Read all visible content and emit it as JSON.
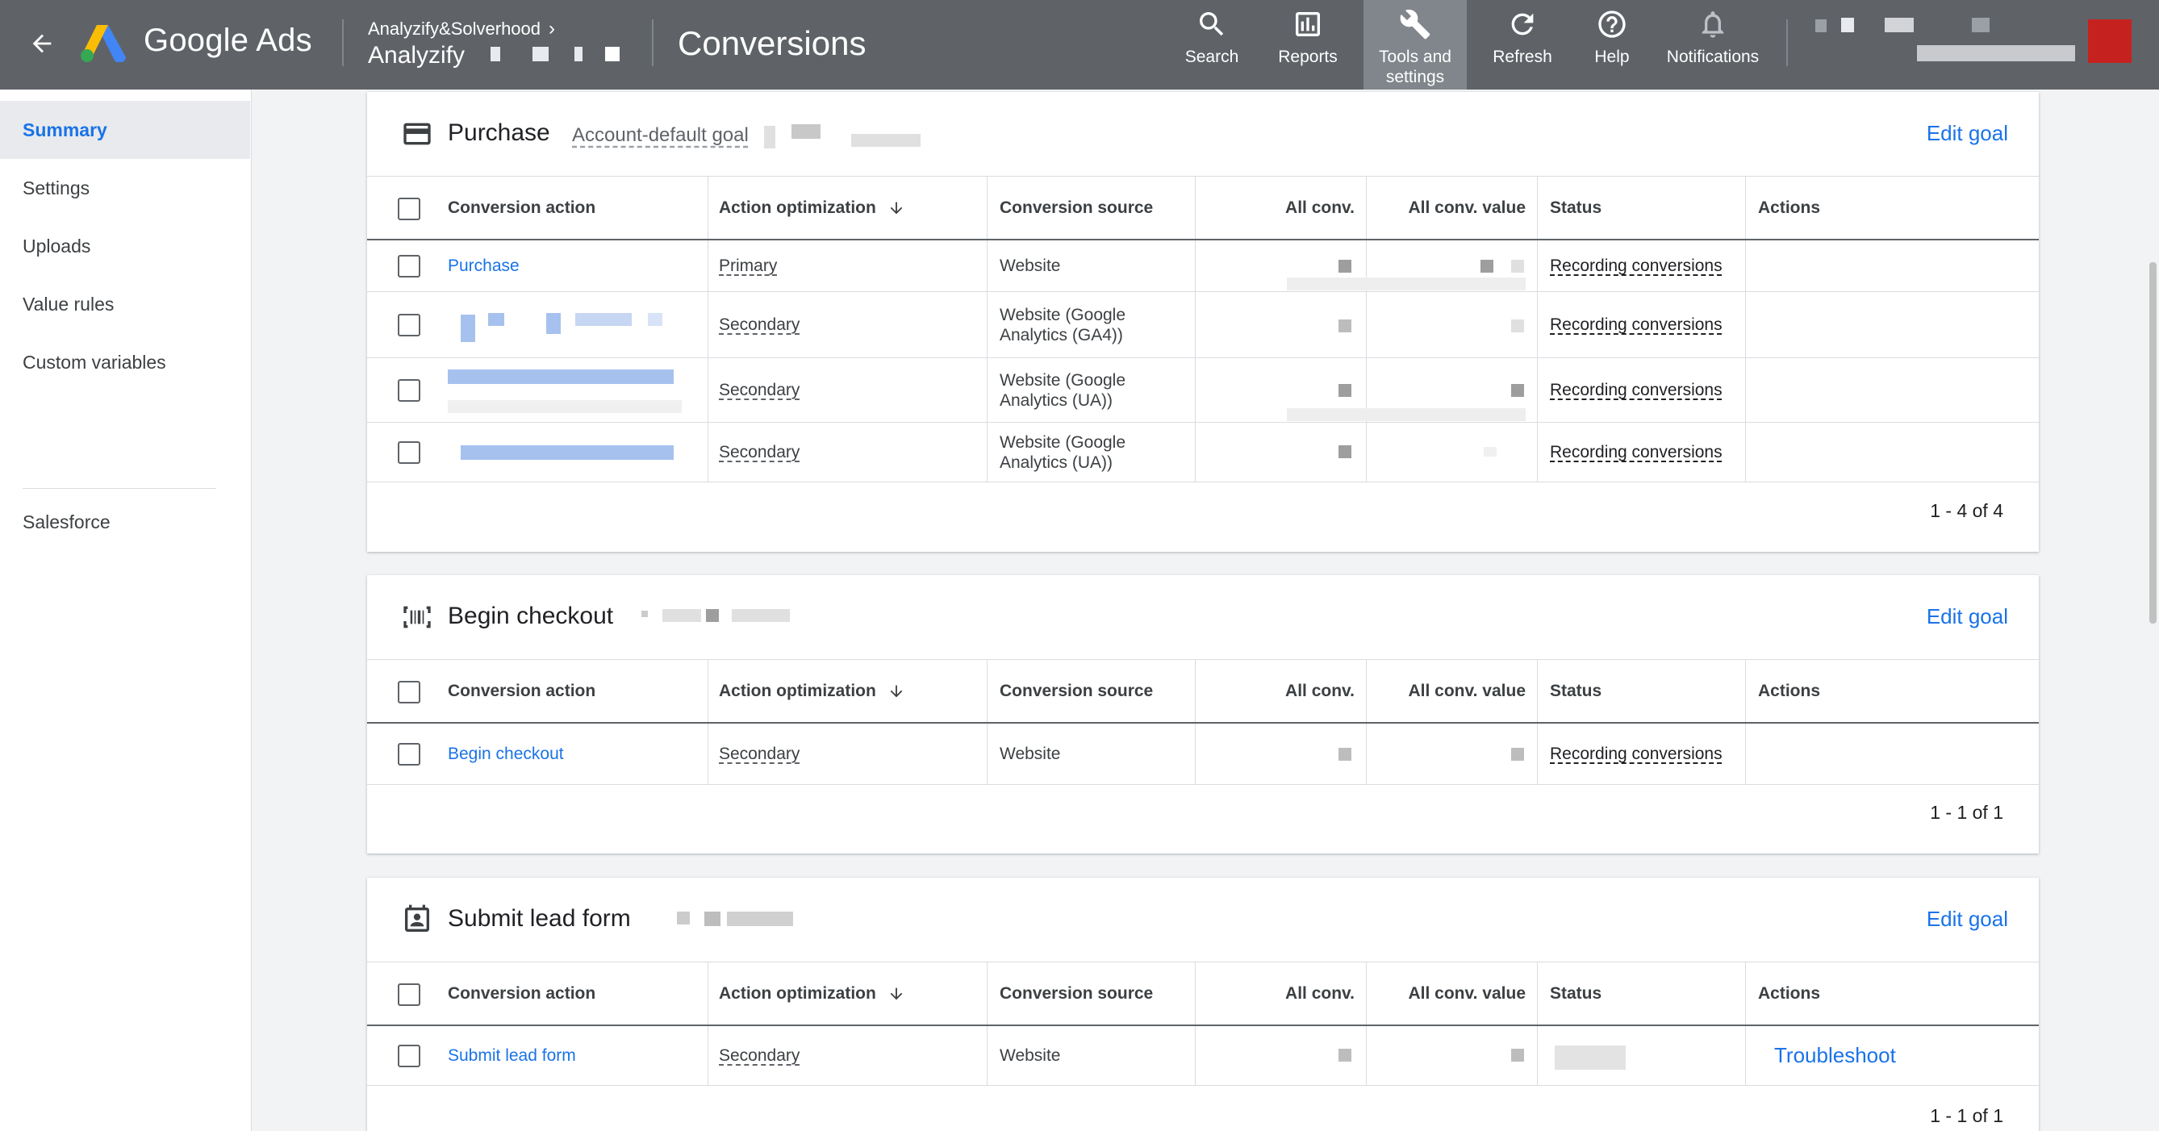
{
  "header": {
    "brand": "Google Ads",
    "account_group": "Analyzify&Solverhood",
    "account_name": "Analyzify",
    "page_title": "Conversions",
    "buttons": [
      {
        "label": "Search",
        "icon": "search-icon"
      },
      {
        "label": "Reports",
        "icon": "reports-icon"
      },
      {
        "label": "Tools and settings",
        "icon": "wrench-icon"
      },
      {
        "label": "Refresh",
        "icon": "refresh-icon"
      },
      {
        "label": "Help",
        "icon": "help-icon"
      },
      {
        "label": "Notifications",
        "icon": "bell-icon"
      }
    ],
    "active_button": "Tools and settings",
    "colors": {
      "bar": "#5f6368",
      "active": "#80868b",
      "avatar": "#c5221f"
    }
  },
  "sidebar": {
    "items": [
      "Summary",
      "Settings",
      "Uploads",
      "Value rules",
      "Custom variables",
      "Salesforce"
    ],
    "active": "Summary"
  },
  "table_headers": {
    "conversion_action": "Conversion action",
    "action_optimization": "Action optimization",
    "conversion_source": "Conversion source",
    "all_conv": "All conv.",
    "all_conv_value": "All conv. value",
    "status": "Status",
    "actions": "Actions"
  },
  "goals": [
    {
      "title": "Purchase",
      "subtitle": "Account-default goal",
      "icon": "credit-card-icon",
      "edit_label": "Edit goal",
      "rows": [
        {
          "action": "Purchase",
          "optimization": "Primary",
          "source": "Website",
          "status": "Recording conversions"
        },
        {
          "action": "",
          "optimization": "Secondary",
          "source": "Website (Google Analytics (GA4))",
          "status": "Recording conversions"
        },
        {
          "action": "",
          "optimization": "Secondary",
          "source": "Website (Google Analytics (UA))",
          "status": "Recording conversions"
        },
        {
          "action": "",
          "optimization": "Secondary",
          "source": "Website (Google Analytics (UA))",
          "status": "Recording conversions"
        }
      ],
      "pagination": "1 - 4 of 4"
    },
    {
      "title": "Begin checkout",
      "subtitle": "",
      "icon": "barcode-icon",
      "edit_label": "Edit goal",
      "rows": [
        {
          "action": "Begin checkout",
          "optimization": "Secondary",
          "source": "Website",
          "status": "Recording conversions"
        }
      ],
      "pagination": "1 - 1 of 1"
    },
    {
      "title": "Submit lead form",
      "subtitle": "",
      "icon": "contact-form-icon",
      "edit_label": "Edit goal",
      "rows": [
        {
          "action": "Submit lead form",
          "optimization": "Secondary",
          "source": "Website",
          "status": "",
          "actions": "Troubleshoot"
        }
      ],
      "pagination": "1 - 1 of 1"
    }
  ],
  "colors": {
    "link": "#1a73e8",
    "background": "#f1f3f4"
  }
}
